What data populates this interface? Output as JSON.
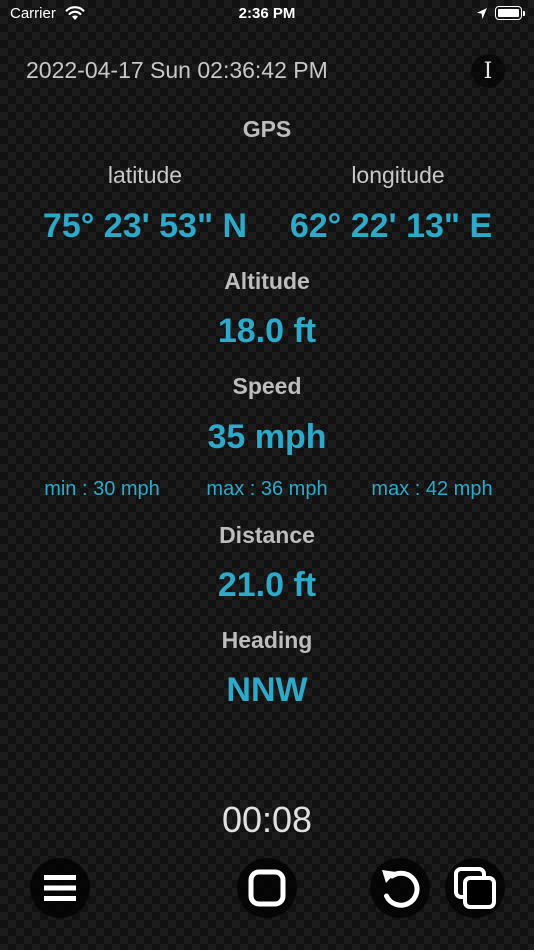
{
  "status_bar": {
    "carrier": "Carrier",
    "time": "2:36 PM"
  },
  "header": {
    "datetime": "2022-04-17 Sun 02:36:42 PM",
    "info_icon": "I"
  },
  "gps": {
    "label": "GPS",
    "latitude_label": "latitude",
    "longitude_label": "longitude",
    "latitude_value": "75° 23' 53\" N",
    "longitude_value": "62° 22' 13\" E"
  },
  "altitude": {
    "label": "Altitude",
    "value": "18.0 ft"
  },
  "speed": {
    "label": "Speed",
    "value": "35 mph",
    "min": "min : 30 mph",
    "max": "max : 36 mph",
    "max2": "max : 42 mph"
  },
  "distance": {
    "label": "Distance",
    "value": "21.0 ft"
  },
  "heading": {
    "label": "Heading",
    "value": "NNW"
  },
  "timer": "00:08",
  "toolbar": {
    "icons": [
      "menu-icon",
      "stop-icon",
      "reset-icon",
      "copy-icon"
    ]
  },
  "colors": {
    "accent": "#2ea9c9",
    "label": "#bdbdbd",
    "text": "#c8c8c8"
  }
}
